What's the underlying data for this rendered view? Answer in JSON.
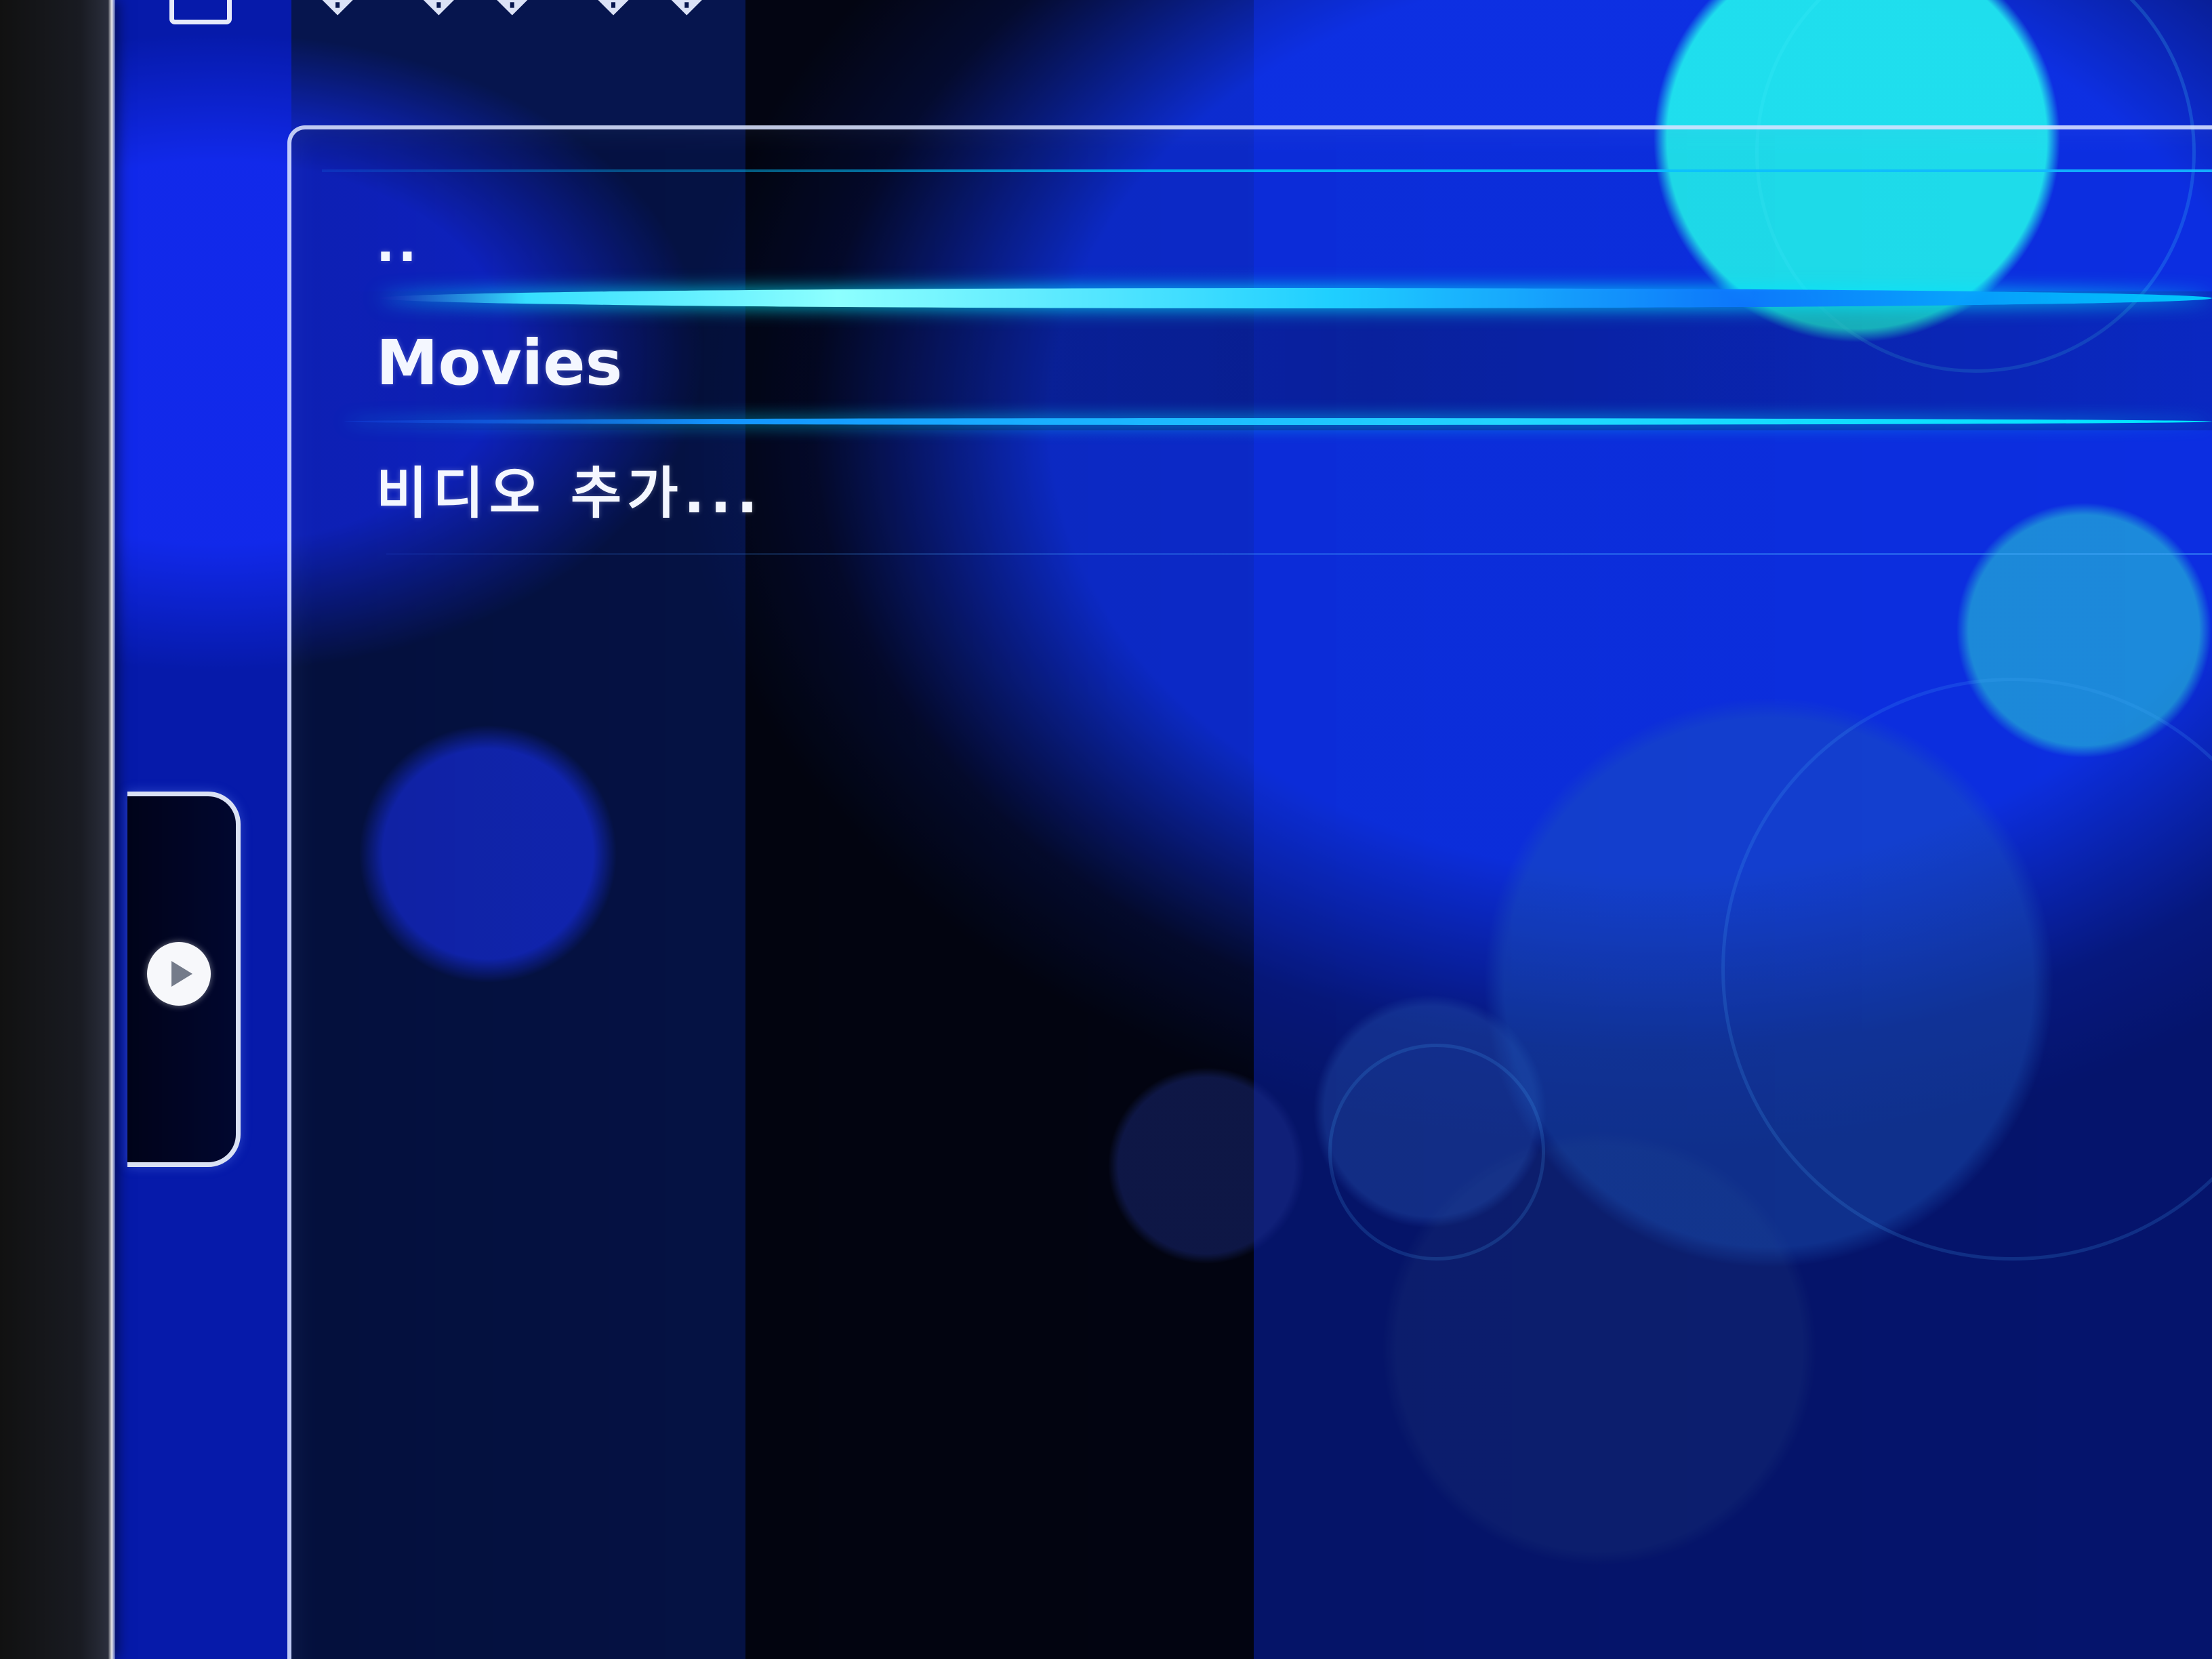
{
  "header": {
    "title": "� ��   ��"
  },
  "file_list": {
    "items": [
      {
        "label": ".."
      },
      {
        "label": "Movies"
      },
      {
        "label": "비디오 추가..."
      }
    ],
    "selected_index": 1
  },
  "side_tab": {
    "icon": "play-arrow-icon"
  },
  "colors": {
    "highlight": "#35dfff",
    "panel_border": "#dae3ff",
    "background_blue": "#0636ff"
  }
}
